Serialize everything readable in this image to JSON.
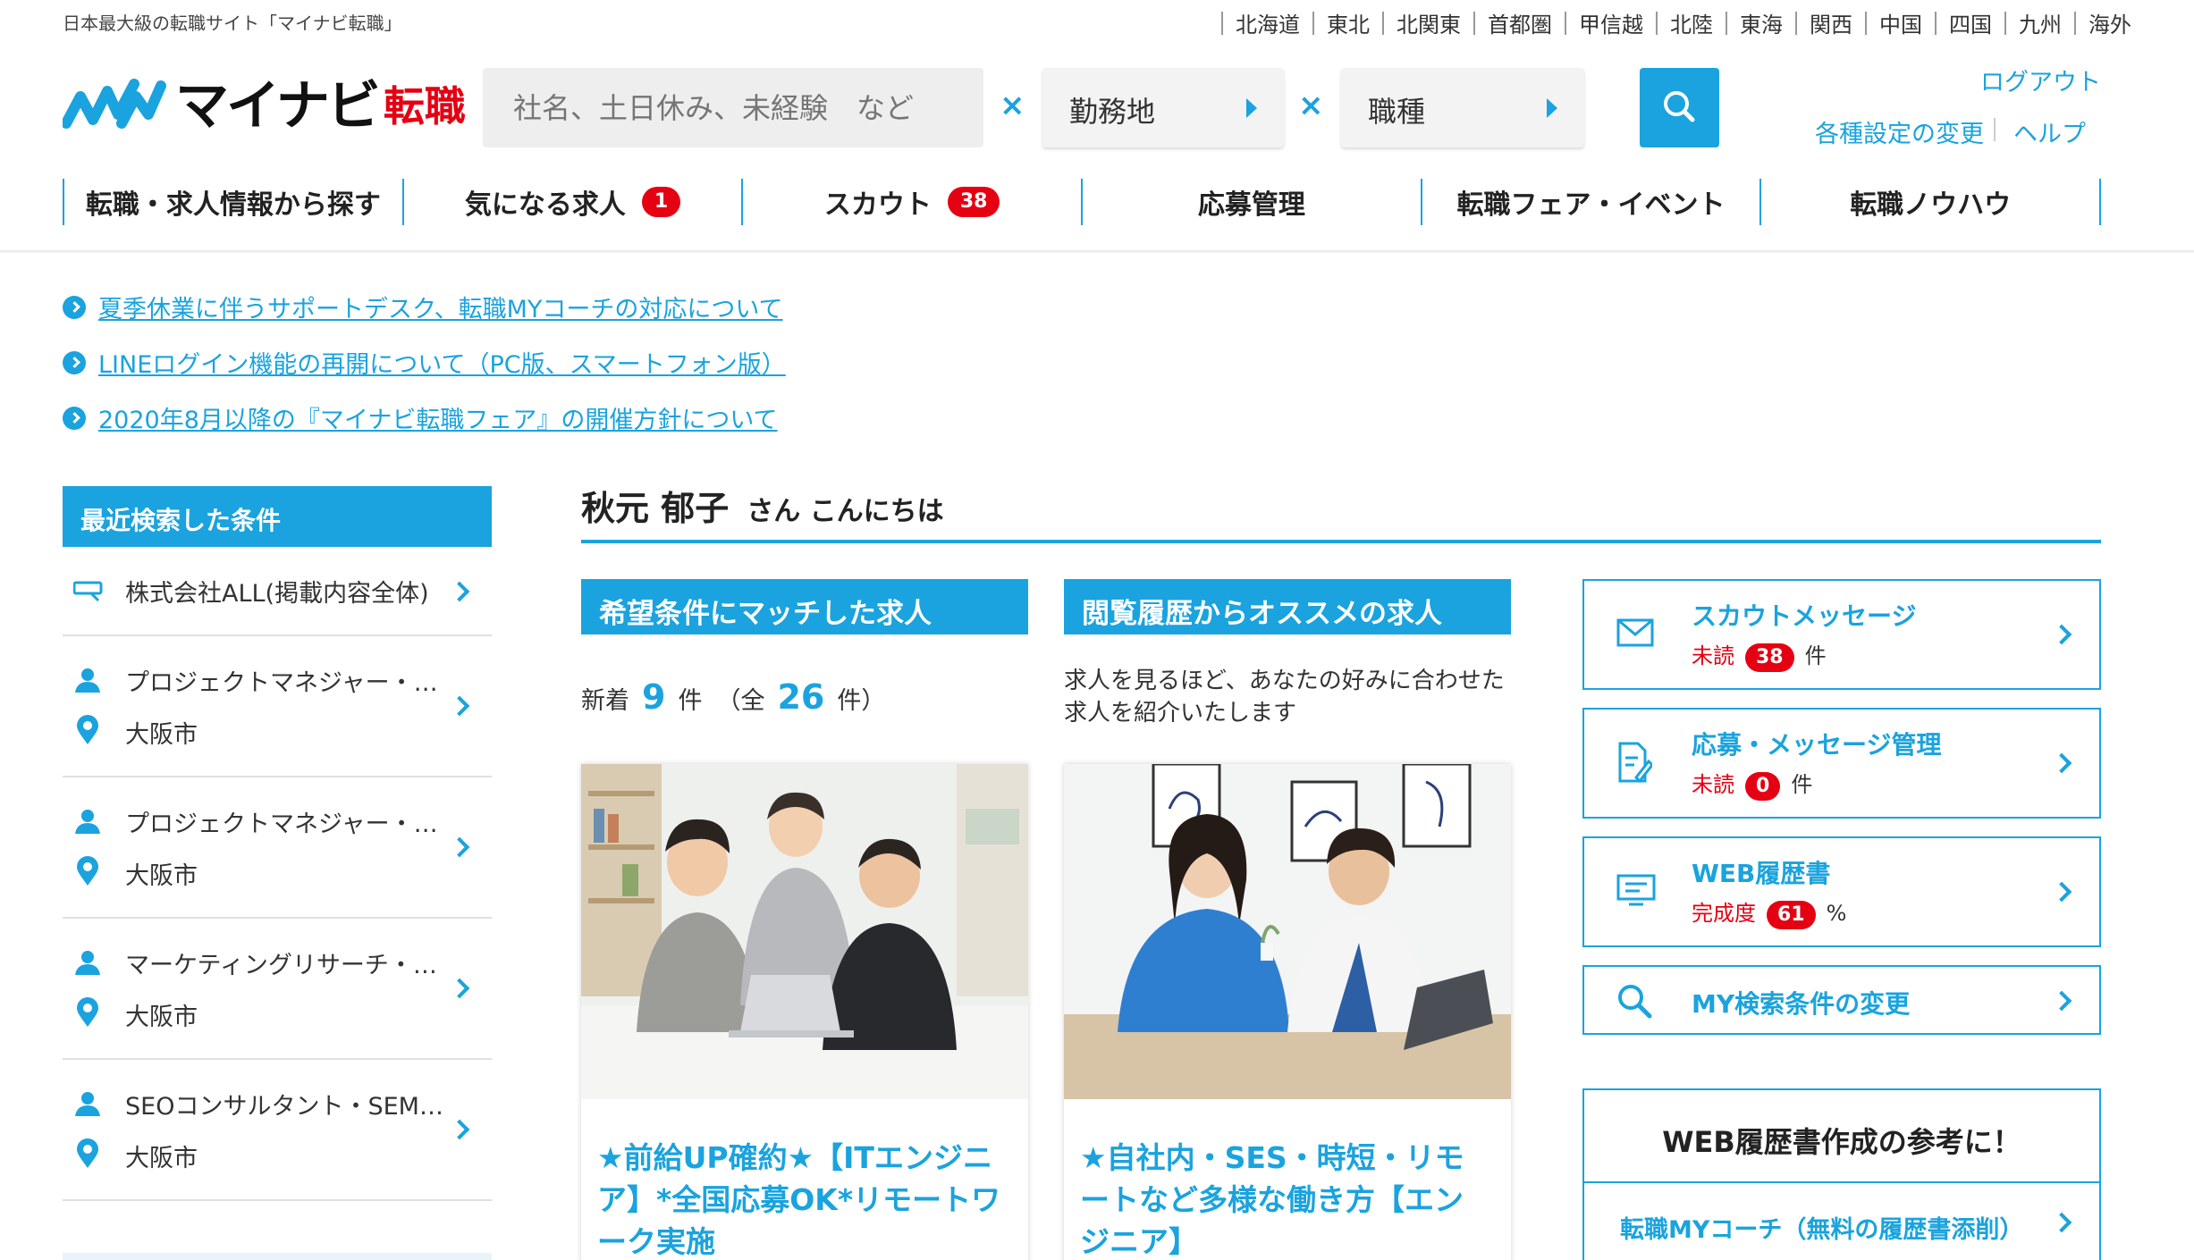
{
  "header": {
    "tagline": "日本最大級の転職サイト「マイナビ転職」",
    "regions": [
      "北海道",
      "東北",
      "北関東",
      "首都圏",
      "甲信越",
      "北陸",
      "東海",
      "関西",
      "中国",
      "四国",
      "九州",
      "海外"
    ],
    "logo_main": "マイナビ",
    "logo_sub": "転職",
    "search": {
      "keyword_placeholder": "社名、土日休み、未経験　など",
      "times": "×",
      "location_label": "勤務地",
      "job_type_label": "職種"
    },
    "logout": "ログアウト",
    "settings": "各種設定の変更",
    "help": "ヘルプ",
    "brand_color": "#1aa3de"
  },
  "nav": [
    {
      "label": "転職・求人情報から探す",
      "badge": null
    },
    {
      "label": "気になる求人",
      "badge": "1"
    },
    {
      "label": "スカウト",
      "badge": "38"
    },
    {
      "label": "応募管理",
      "badge": null
    },
    {
      "label": "転職フェア・イベント",
      "badge": null
    },
    {
      "label": "転職ノウハウ",
      "badge": null
    }
  ],
  "news": [
    "夏季休業に伴うサポートデスク、転職MYコーチの対応について",
    "LINEログイン機能の再開について（PC版、スマートフォン版）",
    "2020年8月以降の『マイナビ転職フェア』の開催方針について"
  ],
  "sidebar": {
    "title": "最近検索した条件",
    "items": [
      {
        "line1": "株式会社ALL(掲載内容全体)",
        "line2": null,
        "icon1": "keyboard-icon"
      },
      {
        "line1": "プロジェクトマネジャー・…",
        "line2": "大阪市",
        "icon1": "person-icon",
        "icon2": "location-pin-icon"
      },
      {
        "line1": "プロジェクトマネジャー・…",
        "line2": "大阪市",
        "icon1": "person-icon",
        "icon2": "location-pin-icon"
      },
      {
        "line1": "マーケティングリサーチ・…",
        "line2": "大阪市",
        "icon1": "person-icon",
        "icon2": "location-pin-icon"
      },
      {
        "line1": "SEOコンサルタント・SEM…",
        "line2": "大阪市",
        "icon1": "person-icon",
        "icon2": "location-pin-icon"
      }
    ]
  },
  "greeting": {
    "name": "秋元 郁子",
    "suffix": "さん こんにちは"
  },
  "matched": {
    "title": "希望条件にマッチした求人",
    "new_prefix": "新着",
    "new_count": "9",
    "unit": "件",
    "total_prefix": "（全",
    "total_count": "26",
    "total_suffix": "件）",
    "job_title": "★前給UP確約★【ITエンジニア】*全国応募OK*リモートワーク実施"
  },
  "history": {
    "title": "閲覧履歴からオススメの求人",
    "description": "求人を見るほど、あなたの好みに合わせた求人を紹介いたします",
    "job_title": "★自社内・SES・時短・リモートなど多様な働き方【エンジニア】"
  },
  "right_panel": {
    "scout": {
      "title": "スカウトメッセージ",
      "label": "未読",
      "count": "38",
      "unit": "件"
    },
    "apply": {
      "title": "応募・メッセージ管理",
      "label": "未読",
      "count": "0",
      "unit": "件"
    },
    "resume": {
      "title": "WEB履歴書",
      "label": "完成度",
      "count": "61",
      "unit": "%"
    },
    "change": {
      "title": "MY検索条件の変更"
    },
    "reference": {
      "title": "WEB履歴書作成の参考に！",
      "item": "転職MYコーチ（無料の履歴書添削）"
    }
  }
}
